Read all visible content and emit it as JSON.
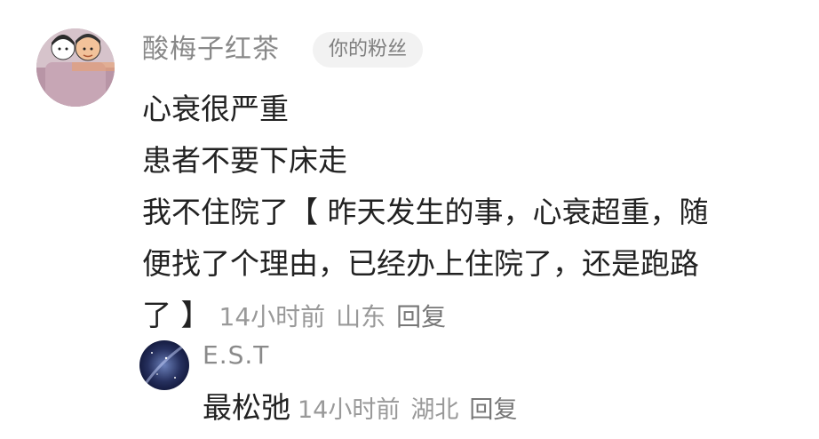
{
  "comment": {
    "username": "酸梅子红茶",
    "badge": "你的粉丝",
    "lines": [
      "心衰很严重",
      "患者不要下床走",
      "我不住院了【 昨天发生的事，心衰超重，随",
      "便找了个理由，已经办上住院了，还是跑路",
      "了 】"
    ],
    "time": "14小时前",
    "location": "山东",
    "reply_label": "回复"
  },
  "reply": {
    "username": "E.S.T",
    "text": "最松弛",
    "time": "14小时前",
    "location": "湖北",
    "reply_label": "回复"
  }
}
